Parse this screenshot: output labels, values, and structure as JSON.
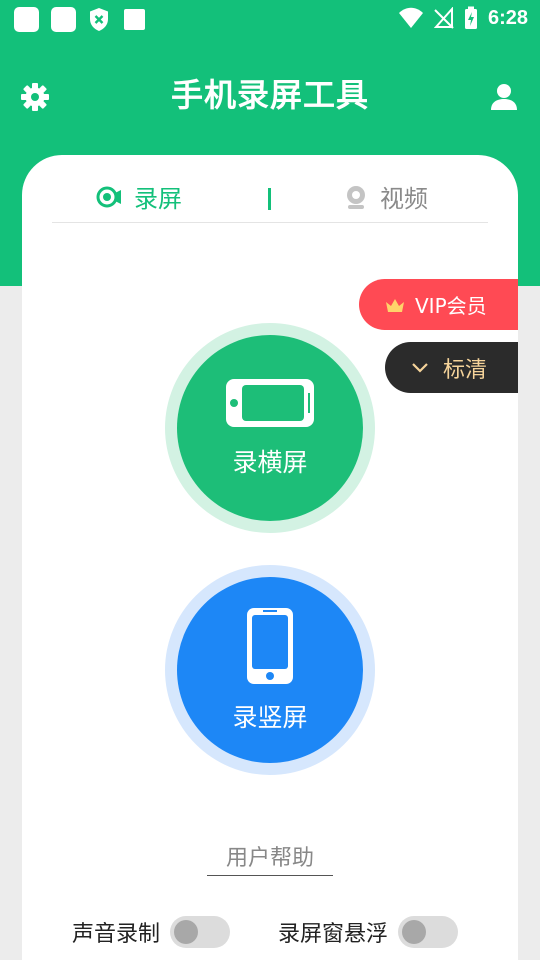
{
  "status_bar": {
    "time": "6:28"
  },
  "header": {
    "title": "手机录屏工具",
    "settings_icon": "gear-icon",
    "profile_icon": "user-icon",
    "bg_color": "#13c07a"
  },
  "tabs": [
    {
      "label": "录屏",
      "icon": "record-icon",
      "active": true
    },
    {
      "label": "视频",
      "icon": "camera-icon",
      "active": false
    }
  ],
  "vip_badge": {
    "label": "VIP会员",
    "icon": "crown-icon",
    "color": "#ff4a54"
  },
  "quality_selector": {
    "label": "标清",
    "icon": "chevron-down-icon"
  },
  "record_landscape": {
    "label": "录横屏",
    "icon": "landscape-phone-icon",
    "color": "#1dbe78"
  },
  "record_portrait": {
    "label": "录竖屏",
    "icon": "portrait-phone-icon",
    "color": "#1d87f6"
  },
  "help_link": {
    "label": "用户帮助"
  },
  "options": {
    "audio": {
      "label": "声音录制",
      "on": false
    },
    "floating": {
      "label": "录屏窗悬浮",
      "on": false
    }
  }
}
